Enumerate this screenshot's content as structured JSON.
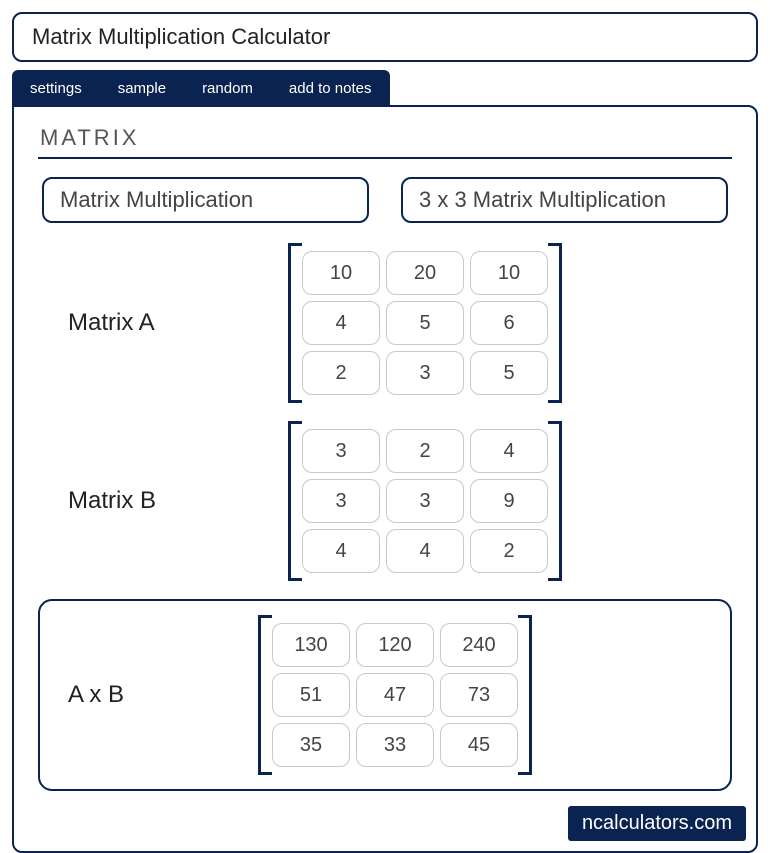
{
  "title": "Matrix Multiplication Calculator",
  "toolbar": {
    "settings": "settings",
    "sample": "sample",
    "random": "random",
    "add_to_notes": "add to notes"
  },
  "section_label": "MATRIX",
  "modes": {
    "generic": "Matrix Multiplication",
    "three_by_three": "3 x 3 Matrix Multiplication"
  },
  "matrix_a": {
    "label": "Matrix A",
    "rows": [
      [
        "10",
        "20",
        "10"
      ],
      [
        "4",
        "5",
        "6"
      ],
      [
        "2",
        "3",
        "5"
      ]
    ]
  },
  "matrix_b": {
    "label": "Matrix B",
    "rows": [
      [
        "3",
        "2",
        "4"
      ],
      [
        "3",
        "3",
        "9"
      ],
      [
        "4",
        "4",
        "2"
      ]
    ]
  },
  "result": {
    "label": "A x B",
    "rows": [
      [
        "130",
        "120",
        "240"
      ],
      [
        "51",
        "47",
        "73"
      ],
      [
        "35",
        "33",
        "45"
      ]
    ]
  },
  "brand": "ncalculators.com"
}
